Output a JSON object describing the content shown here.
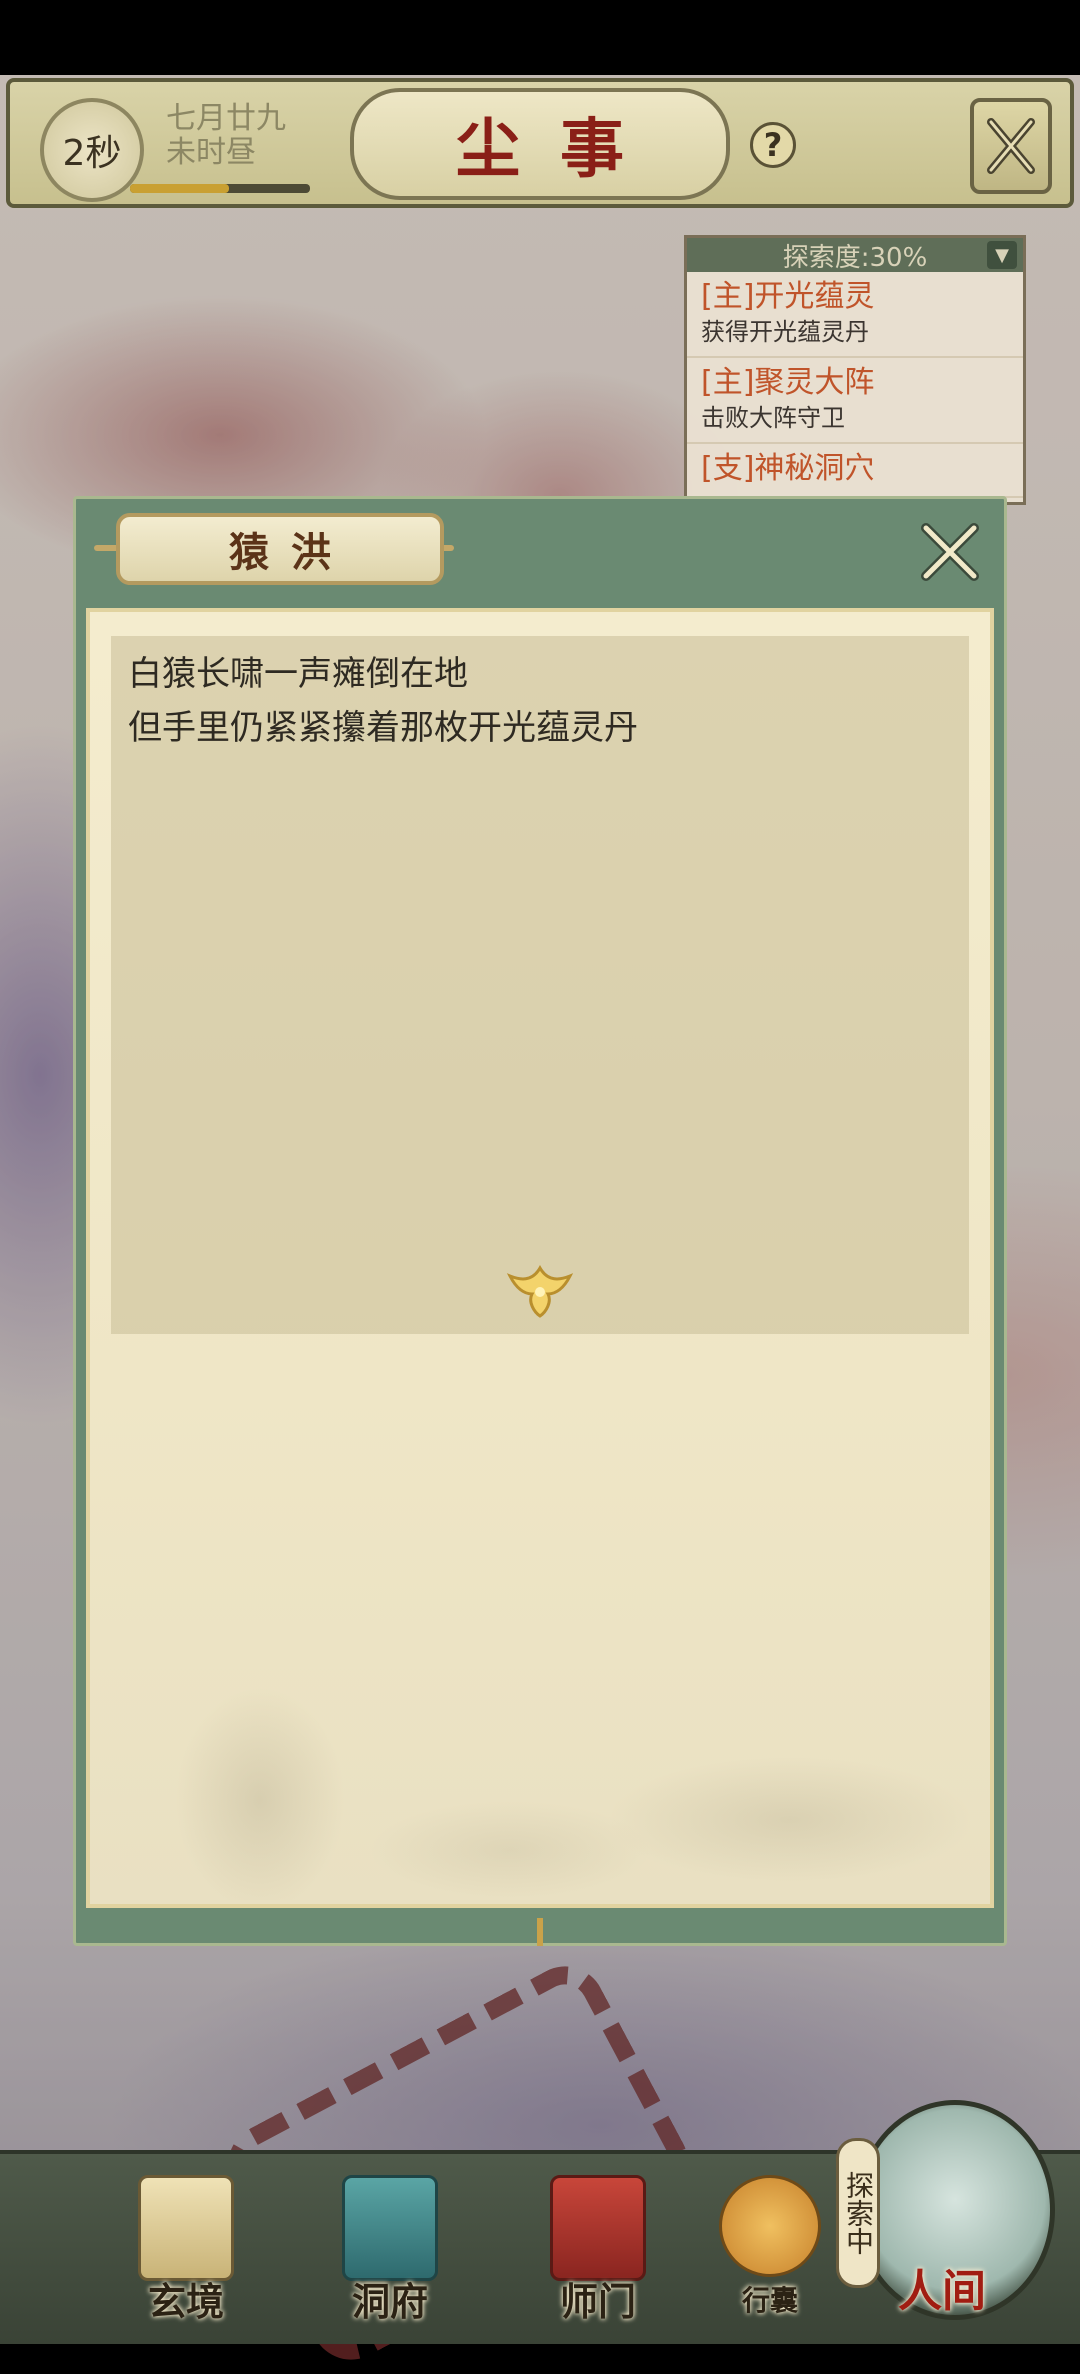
{
  "header": {
    "timer": "2秒",
    "date_line1": "七月廿九",
    "date_line2": "未时昼",
    "title": "尘事",
    "help_label": "?",
    "day_progress": 0.55
  },
  "tracker": {
    "header": "探索度:30%",
    "quests": [
      {
        "title": "[主]开光蕴灵",
        "desc": "获得开光蕴灵丹"
      },
      {
        "title": "[主]聚灵大阵",
        "desc": "击败大阵守卫"
      },
      {
        "title": "[支]神秘洞穴",
        "desc": ""
      }
    ]
  },
  "dialog": {
    "title": "猿洪",
    "lines": [
      "白猿长啸一声瘫倒在地",
      "但手里仍紧紧攥着那枚开光蕴灵丹"
    ]
  },
  "nav": {
    "items": [
      {
        "label": "玄境",
        "icon": "scroll-icon",
        "color": "#d9c892"
      },
      {
        "label": "洞府",
        "icon": "pavilion-icon",
        "color": "#3f8a8a"
      },
      {
        "label": "师门",
        "icon": "banner-icon",
        "color": "#a8312a"
      },
      {
        "label": "行囊",
        "icon": "pouch-icon",
        "color": "#d39a3a"
      }
    ],
    "exploring": "探索中",
    "world": "人间"
  },
  "colors": {
    "dialog_frame": "#6a8a72",
    "paper": "#f4ecce",
    "title_red": "#8a1f17",
    "quest_orange": "#c0542a"
  }
}
